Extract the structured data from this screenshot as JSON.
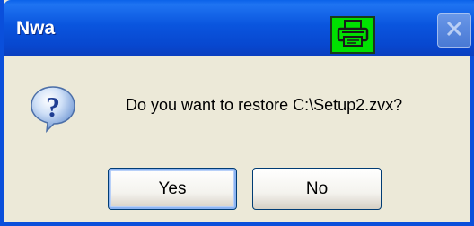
{
  "window": {
    "title": "Nwa",
    "icons": {
      "printer": "printer-icon",
      "close": "close-icon",
      "question": "question-icon"
    }
  },
  "dialog": {
    "message": "Do you want to restore C:\\Setup2.zvx?"
  },
  "buttons": {
    "yes_label": "Yes",
    "no_label": "No"
  },
  "colors": {
    "titlebar": "#0A55DE",
    "dialog_bg": "#ECE9D8",
    "printer_button": "#00E000"
  }
}
